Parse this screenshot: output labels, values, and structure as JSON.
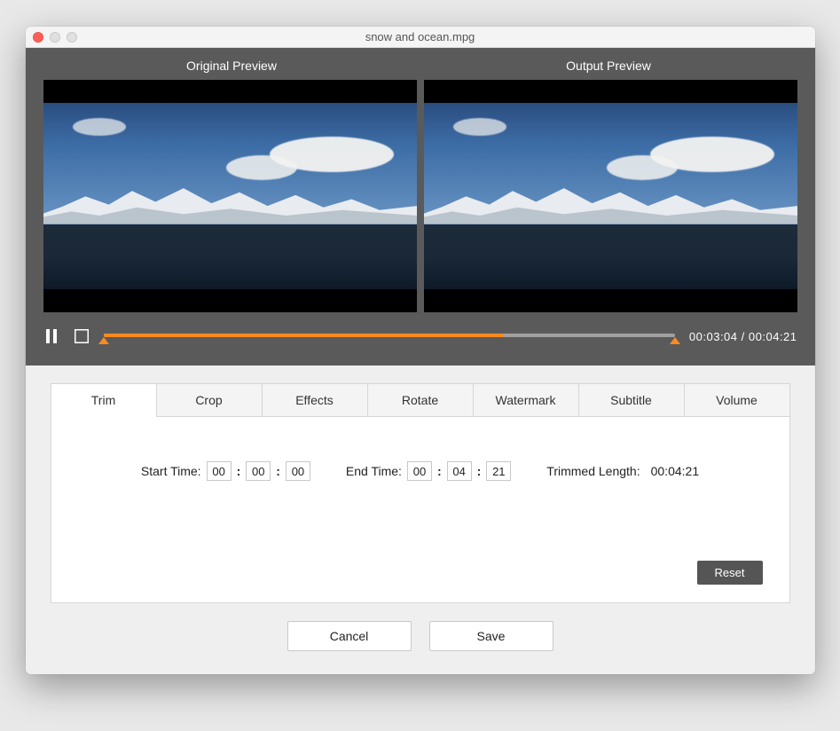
{
  "window": {
    "title": "snow and ocean.mpg"
  },
  "previews": {
    "original_label": "Original Preview",
    "output_label": "Output  Preview"
  },
  "playback": {
    "current_time": "00:03:04",
    "total_time": "00:04:21",
    "separator": "/",
    "progress_pct": 70
  },
  "tabs": [
    {
      "id": "trim",
      "label": "Trim",
      "active": true
    },
    {
      "id": "crop",
      "label": "Crop",
      "active": false
    },
    {
      "id": "effects",
      "label": "Effects",
      "active": false
    },
    {
      "id": "rotate",
      "label": "Rotate",
      "active": false
    },
    {
      "id": "watermark",
      "label": "Watermark",
      "active": false
    },
    {
      "id": "subtitle",
      "label": "Subtitle",
      "active": false
    },
    {
      "id": "volume",
      "label": "Volume",
      "active": false
    }
  ],
  "trim": {
    "start_label": "Start Time:",
    "start": {
      "hh": "00",
      "mm": "00",
      "ss": "00"
    },
    "end_label": "End Time:",
    "end": {
      "hh": "00",
      "mm": "04",
      "ss": "21"
    },
    "length_label": "Trimmed Length:",
    "length_value": "00:04:21",
    "reset_label": "Reset"
  },
  "buttons": {
    "cancel": "Cancel",
    "save": "Save"
  },
  "icons": {
    "pause": "pause-icon",
    "stop": "stop-icon"
  }
}
